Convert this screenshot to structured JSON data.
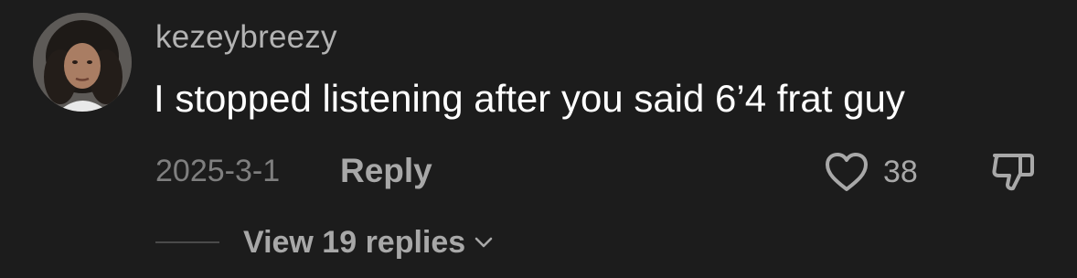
{
  "comment": {
    "username": "kezeybreezy",
    "text": "I stopped listening after you said 6’4 frat guy",
    "date": "2025-3-1",
    "reply_label": "Reply",
    "like_count": "38",
    "view_replies_label": "View 19 replies",
    "icons": {
      "like": "heart-outline-icon",
      "dislike": "thumbs-down-icon",
      "expand": "chevron-down-icon"
    }
  },
  "colors": {
    "background": "#1c1c1c",
    "username": "#b3b3b3",
    "text": "#ffffff",
    "muted": "#7f7f7f",
    "action": "#a8a8a8"
  }
}
